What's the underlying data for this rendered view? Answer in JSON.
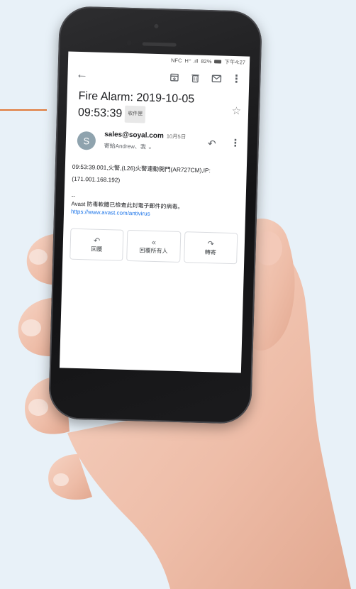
{
  "status_bar": {
    "nfc": "NFC",
    "signal": "H⁺ .ıll",
    "battery_pct": "82%",
    "time": "下午4:27"
  },
  "toolbar": {
    "back_icon": "arrow-left-icon",
    "archive_icon": "archive-icon",
    "delete_icon": "trash-icon",
    "mark_unread_icon": "mail-icon",
    "more_icon": "more-vert-icon"
  },
  "email": {
    "subject_line1": "Fire Alarm: 2019-10-05",
    "subject_line2": "09:53:39",
    "label_chip": "收件匣",
    "sender_initial": "S",
    "sender": "sales@soyal.com",
    "date": "10月5日",
    "recipient": "寄給Andrew、我 ⌄",
    "body_line1": "09:53:39.001,火警,(L26)火警連動開門(AR727CM),IP:",
    "body_line2": "(171.001.168.192)",
    "sig_dash": "--",
    "sig_text": "Avast 防毒軟體已檢查此封電子郵件的病毒。",
    "sig_link": "https://www.avast.com/antivirus"
  },
  "actions": {
    "reply": "回覆",
    "reply_all": "回覆所有人",
    "forward": "轉寄"
  },
  "colors": {
    "accent_line": "#e07a3a",
    "link": "#1a73e8",
    "avatar": "#8fa3ae"
  }
}
